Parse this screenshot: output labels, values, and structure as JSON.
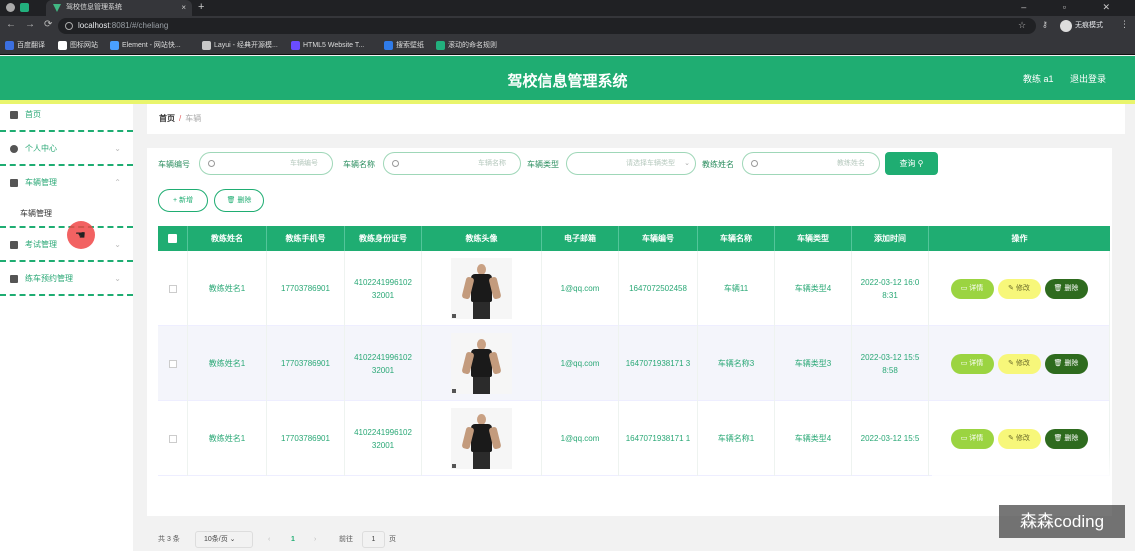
{
  "browser": {
    "tab_title": "驾校信息管理系统",
    "tab_close": "×",
    "new_tab": "+",
    "url_host": "localhost",
    "url_rest": ":8081/#/cheliang",
    "incognito_label": "无痕模式",
    "window_controls": "– ▫ ✕",
    "bookmarks": [
      {
        "label": "百度翻译",
        "color": "#3b6fe0"
      },
      {
        "label": "图标网站",
        "color": "#ffffff"
      },
      {
        "label": "Element - 网站快...",
        "color": "#4aa0ff"
      },
      {
        "label": "Layui - 经典开源模...",
        "color": "#c8c8c8"
      },
      {
        "label": "HTML5 Website T...",
        "color": "#6a4cff"
      },
      {
        "label": "搜索壁纸",
        "color": "#2f7be8"
      },
      {
        "label": "滚动的命名规则",
        "color": "#22b07d"
      }
    ]
  },
  "header": {
    "system_title": "驾校信息管理系统",
    "user": "教练 a1",
    "logout": "退出登录",
    "bg_color": "#1fad72",
    "stripe_color": "#e9f56c"
  },
  "sidebar": {
    "items": [
      {
        "label": "首页"
      },
      {
        "label": "个人中心",
        "chevron": "⌄"
      },
      {
        "label": "车辆管理",
        "chevron": "⌃"
      },
      {
        "label": "车辆管理",
        "sub": true
      },
      {
        "label": "考试管理",
        "chevron": "⌄"
      },
      {
        "label": "练车预约管理",
        "chevron": "⌄"
      }
    ]
  },
  "breadcrumb": {
    "home": "首页",
    "sep": "/",
    "current": "车辆"
  },
  "filters": {
    "vehicle_no_label": "车辆编号",
    "vehicle_no_placeholder": "车辆编号",
    "vehicle_name_label": "车辆名称",
    "vehicle_name_placeholder": "车辆名称",
    "vehicle_type_label": "车辆类型",
    "vehicle_type_placeholder": "请选择车辆类型",
    "coach_name_label": "教练姓名",
    "coach_name_placeholder": "教练姓名",
    "search_btn": "查询 ⚲"
  },
  "actions": {
    "add": "+ 新增",
    "delete": "🗑 删除"
  },
  "table": {
    "headers": [
      "教练姓名",
      "教练手机号",
      "教练身份证号",
      "教练头像",
      "电子邮箱",
      "车辆编号",
      "车辆名称",
      "车辆类型",
      "添加时间",
      "操作"
    ],
    "op_detail": "详情",
    "op_edit": "修改",
    "op_delete": "删除",
    "rows": [
      {
        "name": "教练姓名1",
        "phone": "17703786901",
        "idcard": "4102241996102 32001",
        "email": "1@qq.com",
        "vno": "1647072502458",
        "vname": "车辆11",
        "vtype": "车辆类型4",
        "time": "2022-03-12 16:0 8:31"
      },
      {
        "name": "教练姓名1",
        "phone": "17703786901",
        "idcard": "4102241996102 32001",
        "email": "1@qq.com",
        "vno": "1647071938171 3",
        "vname": "车辆名称3",
        "vtype": "车辆类型3",
        "time": "2022-03-12 15:5 8:58"
      },
      {
        "name": "教练姓名1",
        "phone": "17703786901",
        "idcard": "4102241996102 32001",
        "email": "1@qq.com",
        "vno": "1647071938171 1",
        "vname": "车辆名称1",
        "vtype": "车辆类型4",
        "time": "2022-03-12 15:5"
      }
    ]
  },
  "pagination": {
    "total": "共 3 条",
    "page_size": "10条/页 ⌄",
    "prev": "‹",
    "current": "1",
    "next": "›",
    "goto_label": "前往",
    "goto_value": "1",
    "page_unit": "页"
  },
  "watermark": "森森coding"
}
